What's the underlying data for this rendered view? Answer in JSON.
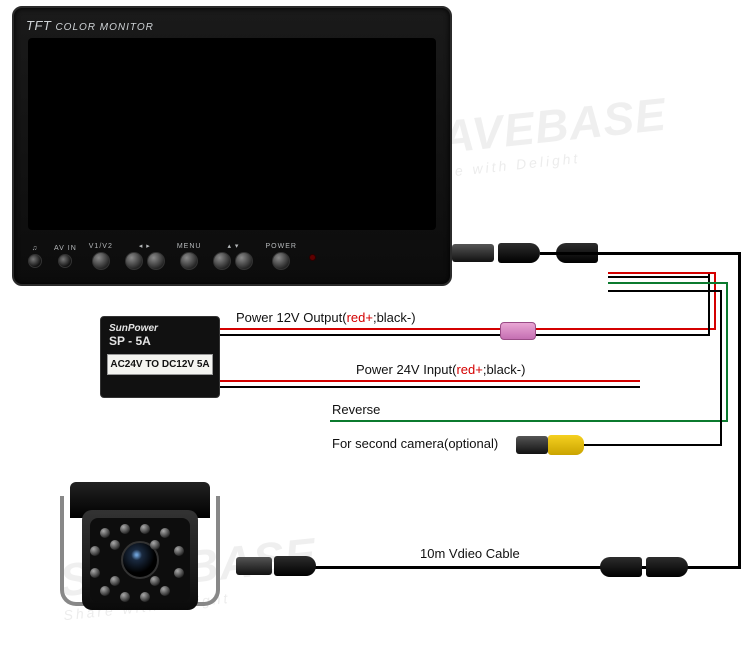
{
  "monitor": {
    "brand_line1": "TFT",
    "brand_line2": "COLOR MONITOR",
    "buttons": {
      "avin": "AV IN",
      "v1v2": "V1/V2",
      "menu": "MENU",
      "power": "POWER"
    }
  },
  "converter": {
    "brand": "SunPower",
    "model": "SP - 5A",
    "spec": "AC24V TO DC12V 5A"
  },
  "labels": {
    "power12_pre": "Power 12V Output(",
    "power12_red": "red+",
    "power12_mid": ";black-)",
    "power24_pre": "Power 24V Input(",
    "power24_red": "red+",
    "power24_mid": ";black-)",
    "reverse": "Reverse",
    "second_cam": "For second camera(optional)",
    "video_cable": "10m  Vdieo Cable"
  },
  "watermark": {
    "main": "SAVEBASE",
    "sub": "Share with Delight"
  },
  "components": {
    "monitor": "tft-color-monitor",
    "converter": "dc-power-converter",
    "camera": "ir-reverse-camera",
    "fuse": "inline-fuse",
    "plug_yellow": "aviation-plug-video2",
    "plug_video": "aviation-plug-video1",
    "cable": "10m-video-cable"
  }
}
